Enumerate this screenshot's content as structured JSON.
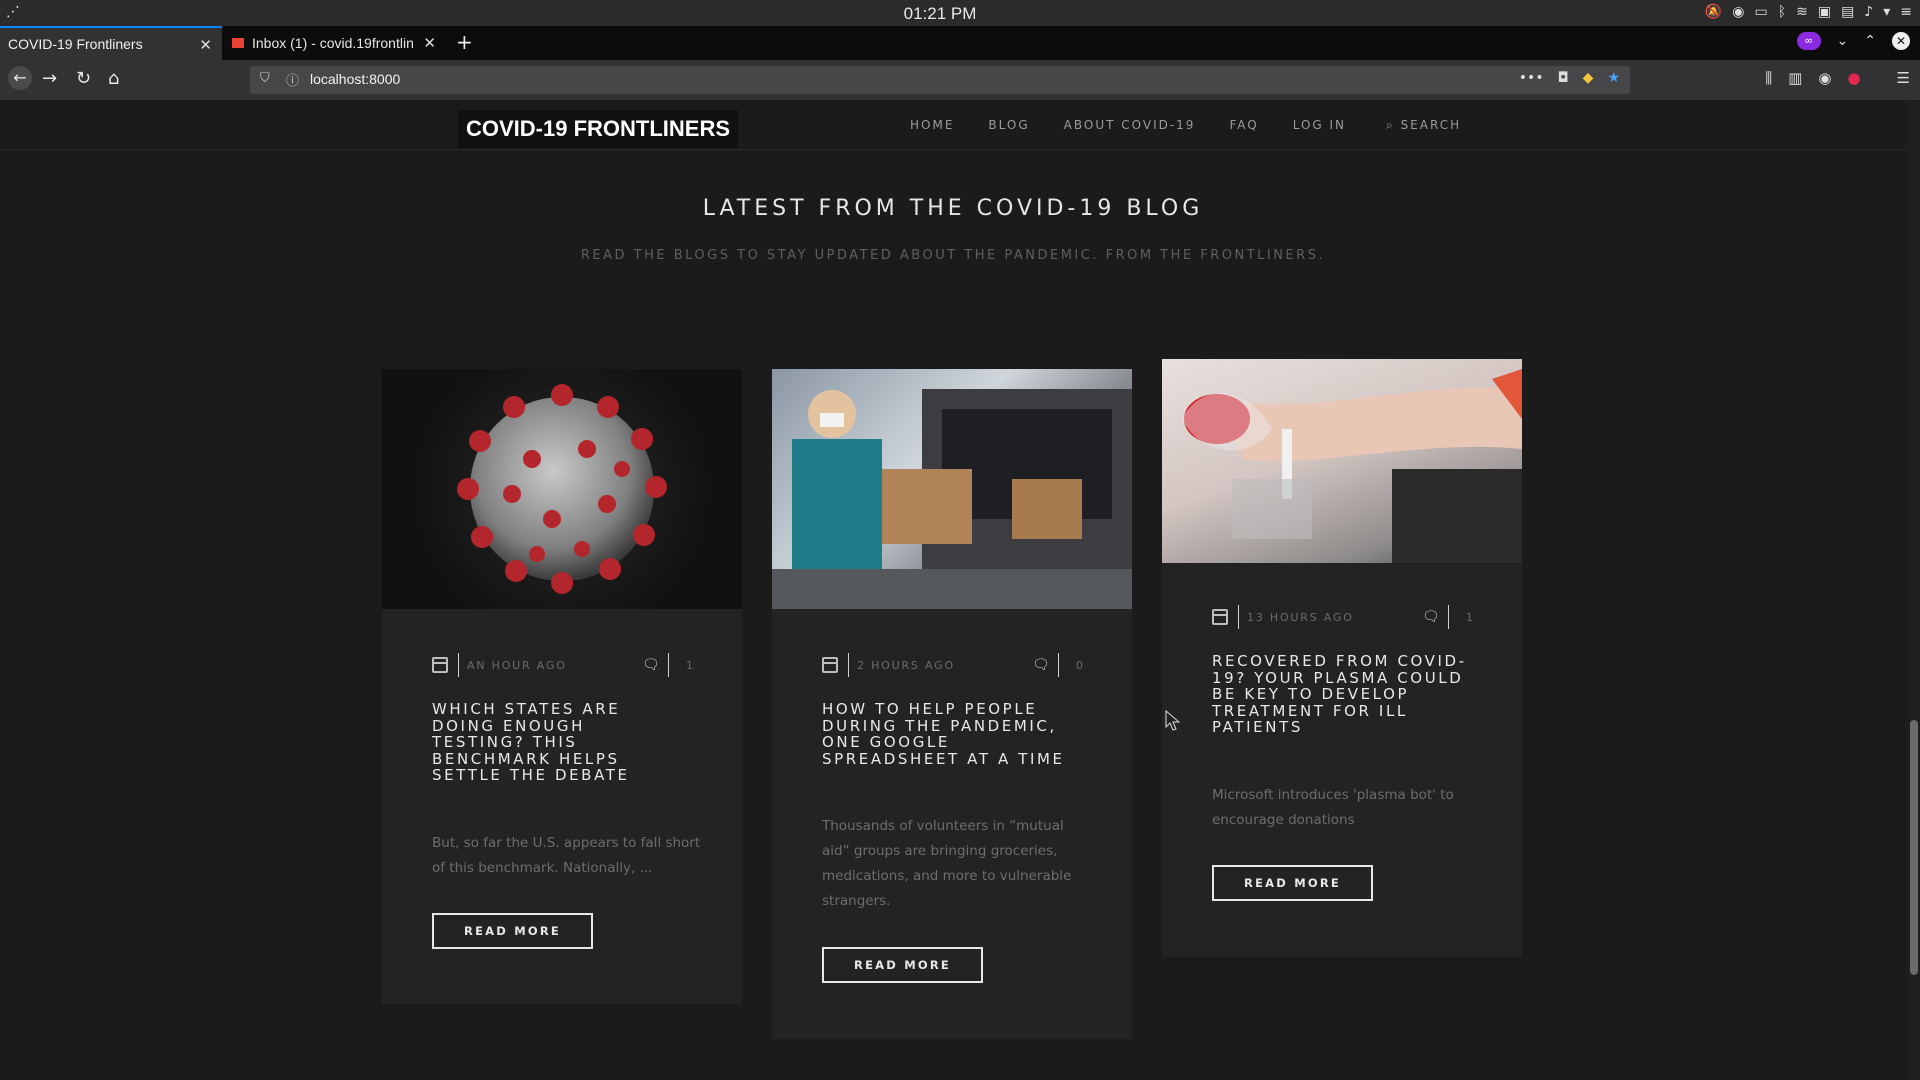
{
  "os": {
    "clock": "01:21 PM"
  },
  "browser": {
    "tabs": [
      {
        "label": "COVID-19 Frontliners"
      },
      {
        "label": "Inbox (1) - covid.19frontlin"
      }
    ],
    "url": "localhost:8000"
  },
  "site": {
    "brand": "COVID-19 FRONTLINERS",
    "menu": [
      "HOME",
      "BLOG",
      "ABOUT COVID-19",
      "FAQ",
      "LOG IN"
    ],
    "search_label": "SEARCH",
    "section_title": "LATEST FROM THE COVID-19 BLOG",
    "section_subtitle": "READ THE BLOGS TO STAY UPDATED ABOUT THE PANDEMIC. FROM THE FRONTLINERS.",
    "posts": [
      {
        "time": "AN HOUR AGO",
        "comments": "1",
        "title": "WHICH STATES ARE DOING ENOUGH TESTING? THIS BENCHMARK HELPS SETTLE THE DEBATE",
        "excerpt": "But, so far the U.S. appears to fall short of this benchmark. Nationally, ...",
        "button": "READ MORE"
      },
      {
        "time": "2 HOURS AGO",
        "comments": "0",
        "title": "HOW TO HELP PEOPLE DURING THE PANDEMIC, ONE GOOGLE SPREADSHEET AT A TIME",
        "excerpt": "Thousands of volunteers in “mutual aid” groups are bringing groceries, medications, and more to vulnerable strangers.",
        "button": "READ MORE"
      },
      {
        "time": "13 HOURS AGO",
        "comments": "1",
        "title": "RECOVERED FROM COVID-19? YOUR PLASMA COULD BE KEY TO DEVELOP TREATMENT FOR ILL PATIENTS",
        "excerpt": "Microsoft introduces 'plasma bot' to encourage donations",
        "button": "READ MORE"
      }
    ]
  }
}
